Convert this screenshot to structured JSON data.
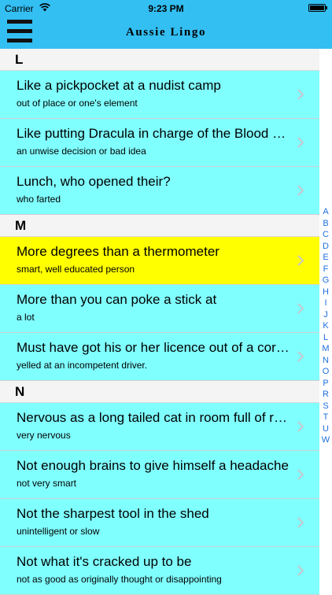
{
  "status_bar": {
    "carrier": "Carrier",
    "time": "9:23 PM"
  },
  "nav": {
    "title": "Aussie Lingo"
  },
  "icons": {
    "menu": "hamburger-menu-icon",
    "wifi": "wifi-icon",
    "battery": "battery-icon",
    "disclosure": "chevron-right-icon"
  },
  "colors": {
    "nav_bar": "#33bff2",
    "row_background": "#80ffff",
    "selected_row": "#ffff00",
    "index_letters": "#1f6fe0"
  },
  "sections": [
    {
      "letter": "L",
      "rows": [
        {
          "title": "Like a pickpocket at a nudist camp",
          "subtitle": "out of place or one's element"
        },
        {
          "title": "Like putting Dracula in charge of the Blood Bank",
          "subtitle": "an unwise decision or bad idea"
        },
        {
          "title": "Lunch, who opened their?",
          "subtitle": "who farted"
        }
      ]
    },
    {
      "letter": "M",
      "rows": [
        {
          "title": "More degrees than a thermometer",
          "subtitle": "smart, well educated person",
          "selected": true
        },
        {
          "title": "More than you can poke a stick at",
          "subtitle": "a lot"
        },
        {
          "title": "Must have got his or her licence out of a cornflakes packet",
          "subtitle": "yelled at an incompetent driver."
        }
      ]
    },
    {
      "letter": "N",
      "rows": [
        {
          "title": "Nervous as a long tailed cat in room full of rocking chairs",
          "subtitle": "very nervous"
        },
        {
          "title": "Not enough brains to give himself a headache",
          "subtitle": "not very smart"
        },
        {
          "title": "Not the sharpest tool in the shed",
          "subtitle": "unintelligent or slow"
        },
        {
          "title": "Not what it's cracked up to be",
          "subtitle": "not as good as originally thought or disappointing"
        }
      ]
    }
  ],
  "index_letters": [
    "A",
    "B",
    "C",
    "D",
    "E",
    "F",
    "G",
    "H",
    "I",
    "J",
    "K",
    "L",
    "M",
    "N",
    "O",
    "P",
    "R",
    "S",
    "T",
    "U",
    "W"
  ]
}
